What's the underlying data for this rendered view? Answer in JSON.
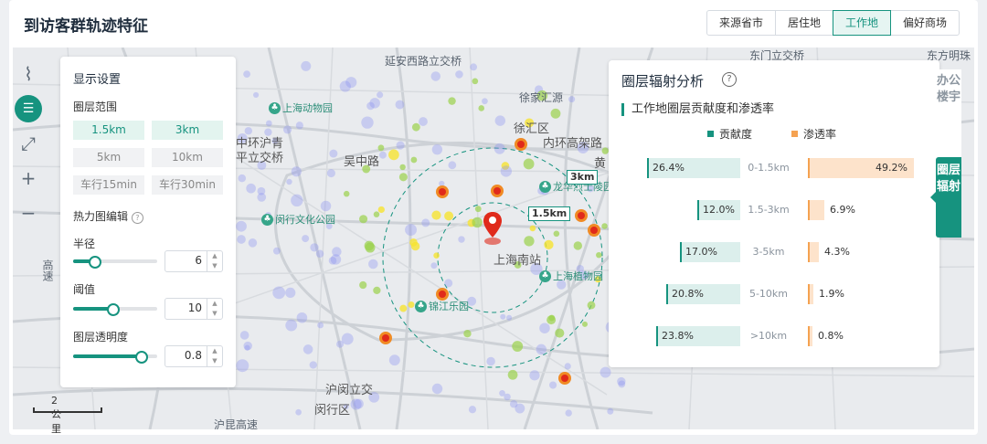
{
  "header": {
    "title": "到访客群轨迹特征",
    "tabs": [
      {
        "label": "来源省市",
        "active": false
      },
      {
        "label": "居住地",
        "active": false
      },
      {
        "label": "工作地",
        "active": true
      },
      {
        "label": "偏好商场",
        "active": false
      }
    ]
  },
  "toolbar": {
    "icons": [
      "ruler-icon",
      "layers-icon",
      "fullscreen-icon",
      "zoom-in-icon",
      "zoom-out-icon"
    ]
  },
  "settings": {
    "title": "显示设置",
    "range_label": "圈层范围",
    "range_options": [
      {
        "label": "1.5km",
        "selected": true
      },
      {
        "label": "3km",
        "selected": true
      },
      {
        "label": "5km",
        "selected": false
      },
      {
        "label": "10km",
        "selected": false
      },
      {
        "label": "车行15min",
        "selected": false
      },
      {
        "label": "车行30min",
        "selected": false
      }
    ],
    "heatmap_label": "热力图编辑",
    "radius_label": "半径",
    "radius_value": "6",
    "radius_level": 0.25,
    "threshold_label": "阈值",
    "threshold_value": "10",
    "threshold_level": 0.47,
    "opacity_label": "图层透明度",
    "opacity_value": "0.8",
    "opacity_level": 0.8
  },
  "map": {
    "labels": [
      "延安西路立交桥",
      "徐家汇源",
      "徐汇区",
      "中环沪青",
      "平立交桥",
      "吴中路",
      "内环高架路",
      "黄",
      "上海南站",
      "沪闵立交",
      "闵行区",
      "高速",
      "沪昆高速",
      "东门立交桥",
      "东方明珠"
    ],
    "pois": [
      "上海动物园",
      "闵行文化公园",
      "上海植物园",
      "锦江乐园",
      "龙华烈士陵园"
    ],
    "ring_labels": [
      "3km",
      "1.5km"
    ],
    "scale": "2 公里",
    "heat_colors": [
      "#8a8ff0",
      "#9ad24a",
      "#f6e431",
      "#f08a24",
      "#e02a1b"
    ]
  },
  "analysis": {
    "title": "圈层辐射分析",
    "subtitle": "工作地圈层贡献度和渗透率",
    "legend_contribution": "贡献度",
    "legend_penetration": "渗透率",
    "contribution_color": "#16937f",
    "penetration_color": "#f5a251",
    "rows": [
      {
        "range": "0-1.5km",
        "contribution": "26.4%",
        "contribution_value": 26.4,
        "penetration": "49.2%",
        "penetration_value": 49.2
      },
      {
        "range": "1.5-3km",
        "contribution": "12.0%",
        "contribution_value": 12.0,
        "penetration": "6.9%",
        "penetration_value": 6.9
      },
      {
        "range": "3-5km",
        "contribution": "17.0%",
        "contribution_value": 17.0,
        "penetration": "4.3%",
        "penetration_value": 4.3
      },
      {
        "range": "5-10km",
        "contribution": "20.8%",
        "contribution_value": 20.8,
        "penetration": "1.9%",
        "penetration_value": 1.9
      },
      {
        "range": ">10km",
        "contribution": "23.8%",
        "contribution_value": 23.8,
        "penetration": "0.8%",
        "penetration_value": 0.8
      }
    ]
  },
  "side_tabs": {
    "office": "办公楼宇",
    "radiation": "圈层辐射"
  }
}
